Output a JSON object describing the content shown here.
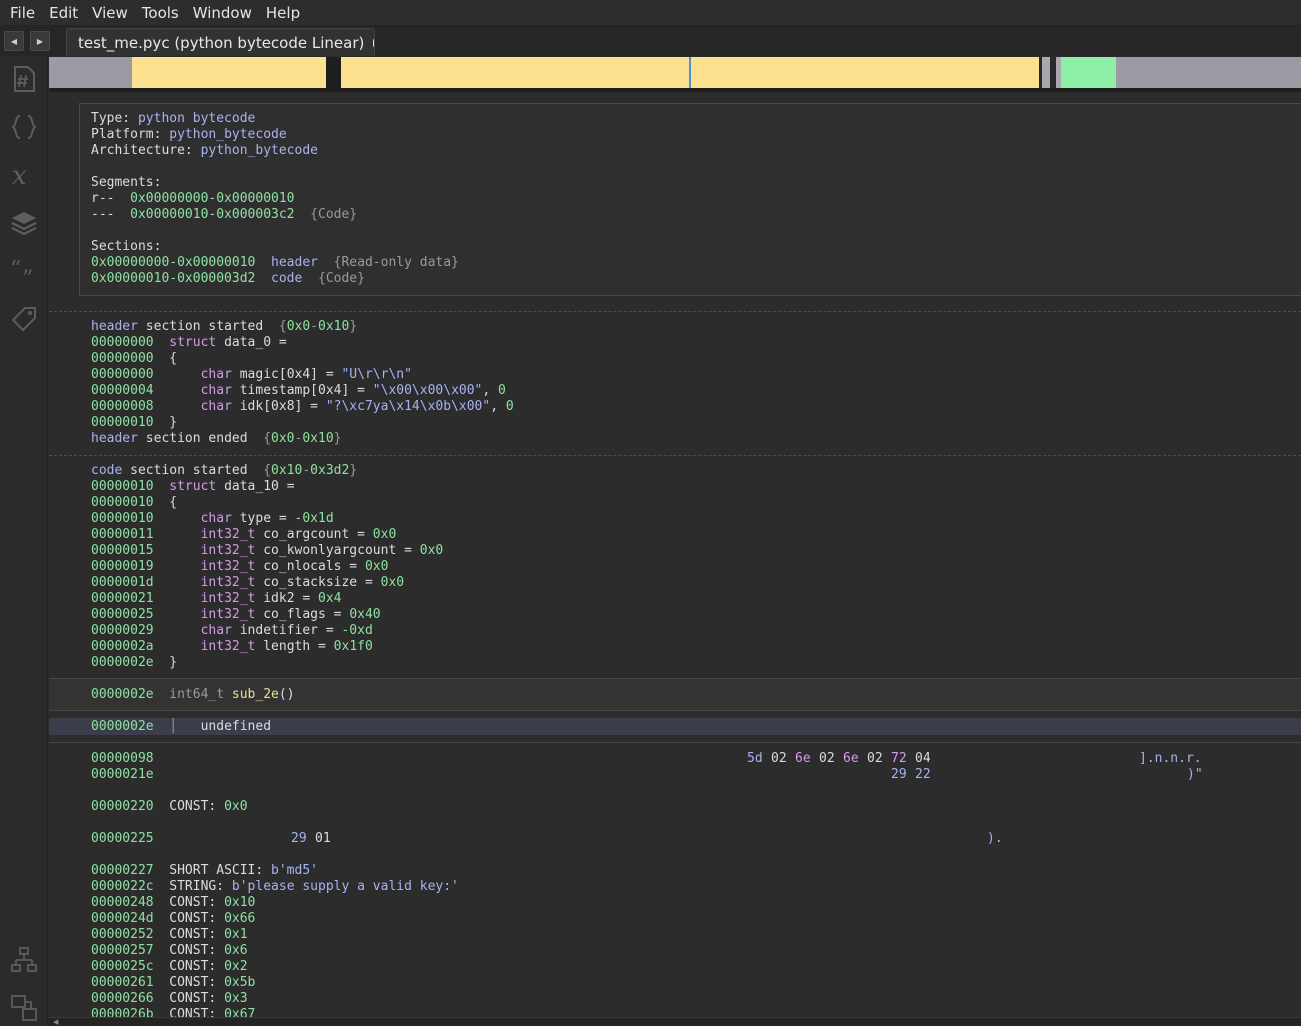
{
  "menu": [
    "File",
    "Edit",
    "View",
    "Tools",
    "Window",
    "Help"
  ],
  "tab": {
    "title": "test_me.pyc (python bytecode Linear)"
  },
  "sidebar": {
    "icons": [
      "symbols-hash-icon",
      "types-braces-icon",
      "variables-x-icon",
      "layers-icon",
      "strings-quote-icon",
      "tags-icon",
      "graph-icon",
      "cross-reference-icon"
    ]
  },
  "colors": {
    "featuremap_background": "#9b9ba4",
    "featuremap_data": "#fbe190",
    "featuremap_code": "#8ef0a6",
    "address": "#8ee0a0",
    "keyword": "#d79ae8",
    "string": "#a7b3f0"
  },
  "info": {
    "type_label": "Type:",
    "type": "python bytecode",
    "platform_label": "Platform:",
    "platform": "python_bytecode",
    "arch_label": "Architecture:",
    "arch": "python_bytecode",
    "segments_label": "Segments:",
    "segments": [
      {
        "perm": "r--",
        "range": "0x00000000-0x00000010",
        "kind": ""
      },
      {
        "perm": "---",
        "range": "0x00000010-0x000003c2",
        "kind": "{Code}"
      }
    ],
    "sections_label": "Sections:",
    "sections": [
      {
        "range": "0x00000000-0x00000010",
        "name": "header",
        "kind": "{Read-only data}"
      },
      {
        "range": "0x00000010-0x000003d2",
        "name": "code",
        "kind": "{Code}"
      }
    ]
  },
  "header_section": {
    "start": {
      "name": "header",
      "text": "section started",
      "range": "{0x0-0x10}"
    },
    "lines": [
      {
        "addr": "00000000",
        "indent": "",
        "kw": "struct",
        "rest": " data_0 ="
      },
      {
        "addr": "00000000",
        "indent": "",
        "kw": "",
        "rest": "{"
      },
      {
        "addr": "00000000",
        "indent": "    ",
        "kw": "char",
        "rest": " magic[0x4] = ",
        "str": "\"U\\r\\r\\n\""
      },
      {
        "addr": "00000004",
        "indent": "    ",
        "kw": "char",
        "rest": " timestamp[0x4] = ",
        "str": "\"\\x00\\x00\\x00\"",
        "tail": ", ",
        "num": "0"
      },
      {
        "addr": "00000008",
        "indent": "    ",
        "kw": "char",
        "rest": " idk[0x8] = ",
        "str": "\"?\\xc7ya\\x14\\x0b\\x00\"",
        "tail": ", ",
        "num": "0"
      },
      {
        "addr": "00000010",
        "indent": "",
        "kw": "",
        "rest": "}"
      }
    ],
    "end": {
      "name": "header",
      "text": "section ended",
      "range": "{0x0-0x10}"
    }
  },
  "code_section": {
    "start": {
      "name": "code",
      "text": "section started",
      "range": "{0x10-0x3d2}"
    },
    "lines": [
      {
        "addr": "00000010",
        "indent": "",
        "kw": "struct",
        "rest": " data_10 ="
      },
      {
        "addr": "00000010",
        "indent": "",
        "kw": "",
        "rest": "{"
      },
      {
        "addr": "00000010",
        "indent": "    ",
        "kw": "char",
        "rest": " type = ",
        "num": "-0x1d"
      },
      {
        "addr": "00000011",
        "indent": "    ",
        "kw": "int32_t",
        "rest": " co_argcount = ",
        "num": "0x0"
      },
      {
        "addr": "00000015",
        "indent": "    ",
        "kw": "int32_t",
        "rest": " co_kwonlyargcount = ",
        "num": "0x0"
      },
      {
        "addr": "00000019",
        "indent": "    ",
        "kw": "int32_t",
        "rest": " co_nlocals = ",
        "num": "0x0"
      },
      {
        "addr": "0000001d",
        "indent": "    ",
        "kw": "int32_t",
        "rest": " co_stacksize = ",
        "num": "0x0"
      },
      {
        "addr": "00000021",
        "indent": "    ",
        "kw": "int32_t",
        "rest": " idk2 = ",
        "num": "0x4"
      },
      {
        "addr": "00000025",
        "indent": "    ",
        "kw": "int32_t",
        "rest": " co_flags = ",
        "num": "0x40"
      },
      {
        "addr": "00000029",
        "indent": "    ",
        "kw": "char",
        "rest": " indetifier = ",
        "num": "-0xd"
      },
      {
        "addr": "0000002a",
        "indent": "    ",
        "kw": "int32_t",
        "rest": " length = ",
        "num": "0x1f0"
      },
      {
        "addr": "0000002e",
        "indent": "",
        "kw": "",
        "rest": "}"
      }
    ]
  },
  "function": {
    "addr": "0000002e",
    "ret": "int64_t",
    "name": "sub_2e",
    "args": "()"
  },
  "body": {
    "addr": "0000002e",
    "text": "undefined"
  },
  "hex_rows": [
    {
      "addr": "00000098",
      "bytes": [
        "5d",
        "02",
        "6e",
        "02",
        "6e",
        "02",
        "72",
        "04"
      ],
      "ascii": "].n.n.r."
    },
    {
      "addr": "0000021e",
      "bytes": [
        "29",
        "22"
      ],
      "ascii": ")\""
    }
  ],
  "const_line_1": {
    "addr": "00000220",
    "label": "CONST:",
    "value": "0x0"
  },
  "hex_row_2": {
    "addr": "00000225",
    "bytes": [
      "29",
      "01"
    ],
    "ascii": ")."
  },
  "data_items": [
    {
      "addr": "00000227",
      "label": "SHORT ASCII:",
      "value": "b'md5'"
    },
    {
      "addr": "0000022c",
      "label": "STRING:",
      "value": "b'please supply a valid key:'"
    },
    {
      "addr": "00000248",
      "label": "CONST:",
      "value": "0x10"
    },
    {
      "addr": "0000024d",
      "label": "CONST:",
      "value": "0x66"
    },
    {
      "addr": "00000252",
      "label": "CONST:",
      "value": "0x1"
    },
    {
      "addr": "00000257",
      "label": "CONST:",
      "value": "0x6"
    },
    {
      "addr": "0000025c",
      "label": "CONST:",
      "value": "0x2"
    },
    {
      "addr": "00000261",
      "label": "CONST:",
      "value": "0x5b"
    },
    {
      "addr": "00000266",
      "label": "CONST:",
      "value": "0x3"
    },
    {
      "addr": "0000026b",
      "label": "CONST:",
      "value": "0x67"
    }
  ]
}
